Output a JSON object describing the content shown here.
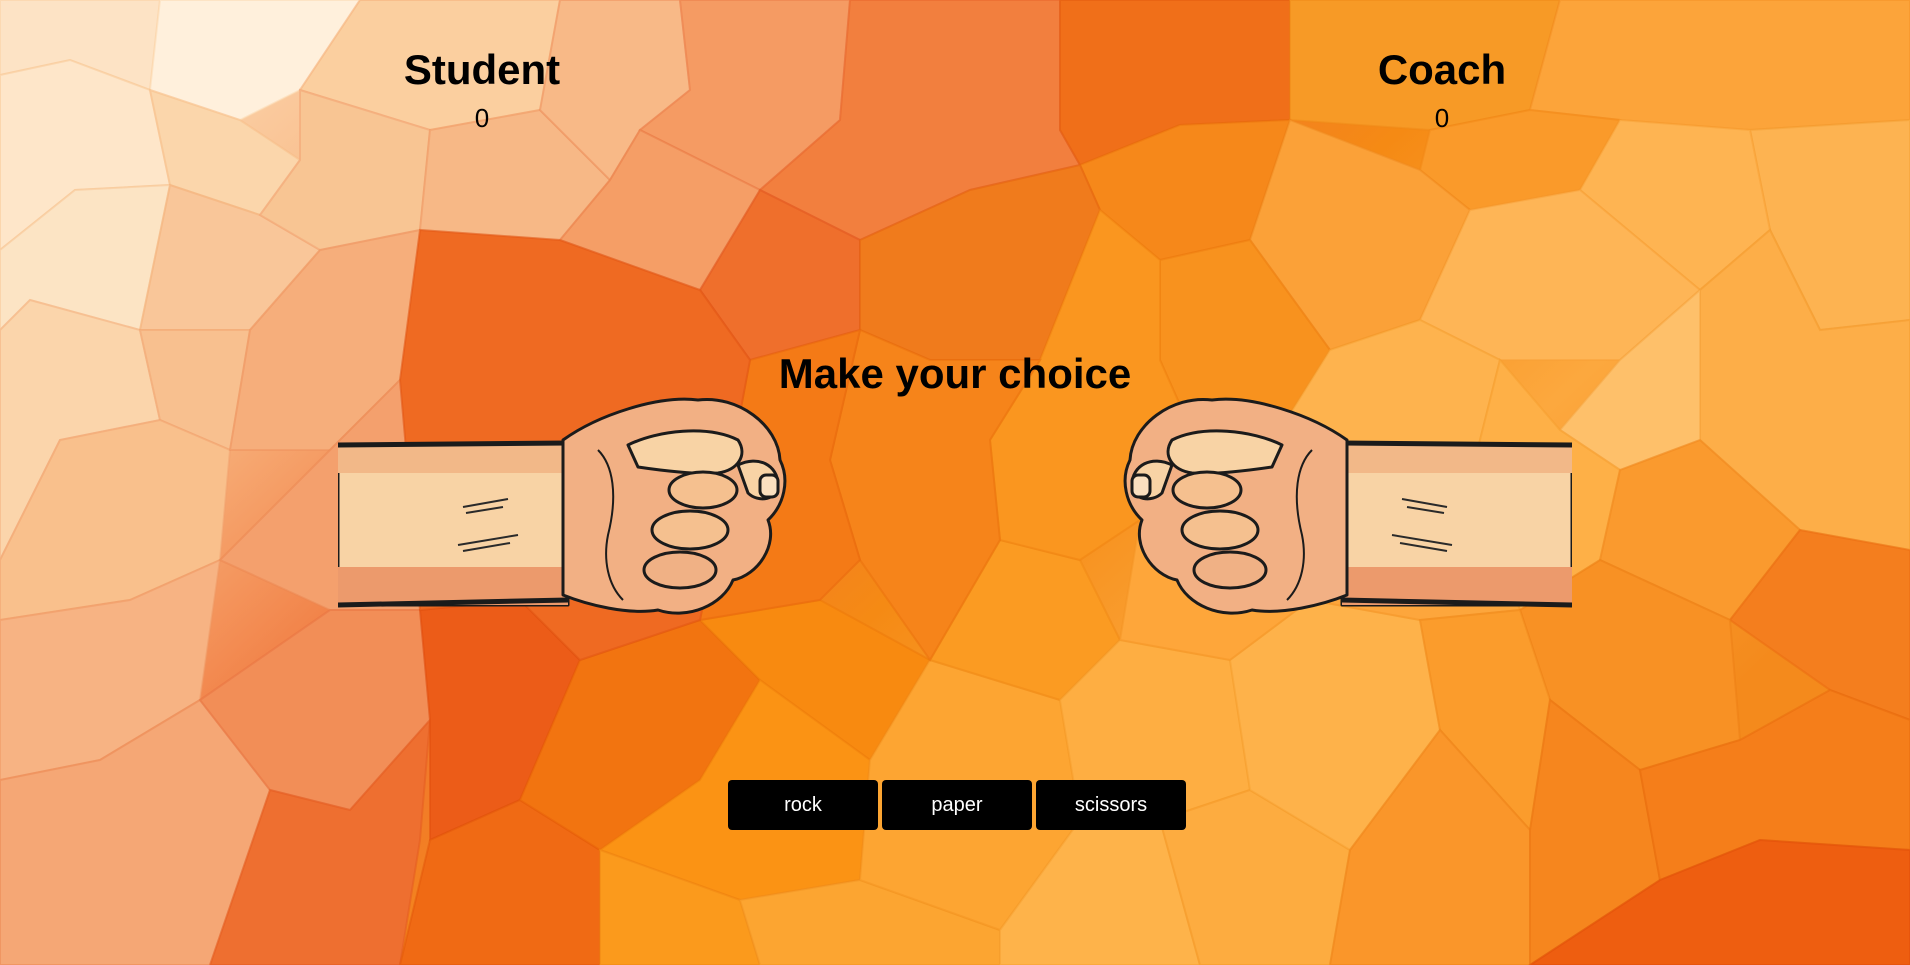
{
  "players": {
    "student": {
      "name": "Student",
      "score": "0"
    },
    "coach": {
      "name": "Coach",
      "score": "0"
    }
  },
  "prompt": "Make your choice",
  "choices": [
    "rock",
    "paper",
    "scissors"
  ],
  "icons": {
    "left_hand": "fist-icon",
    "right_hand": "fist-icon"
  },
  "colors": {
    "button_bg": "#000000",
    "button_text": "#ffffff",
    "skin_light": "#f8d3a5",
    "skin_mid": "#efad7e",
    "skin_dark": "#e08a5a",
    "outline": "#1b1b1b",
    "accent_orange": "#f38305"
  }
}
